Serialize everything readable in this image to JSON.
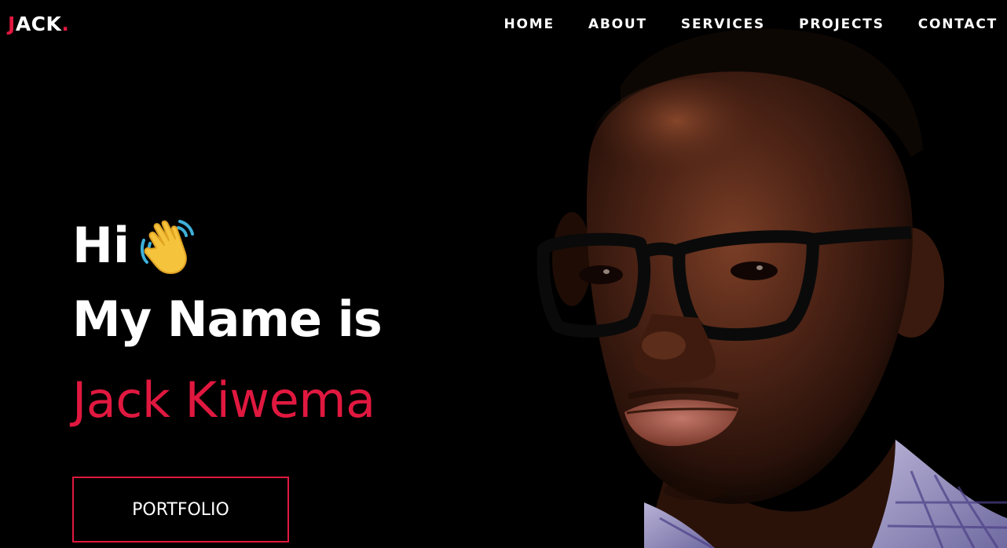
{
  "brand": {
    "logo_first": "J",
    "logo_rest": "ACK",
    "logo_dot": ".",
    "accent_color": "#e0183f"
  },
  "nav": {
    "items": [
      {
        "label": "HOME"
      },
      {
        "label": "ABOUT"
      },
      {
        "label": "SERVICES"
      },
      {
        "label": "PROJECTS"
      },
      {
        "label": "CONTACT"
      }
    ]
  },
  "hero": {
    "greeting": "Hi",
    "greeting_icon": "waving-hand-icon",
    "title": "My Name is",
    "name": "Jack Kiwema",
    "button_label": "PORTFOLIO"
  },
  "portrait": {
    "icon": "portrait-photo"
  }
}
